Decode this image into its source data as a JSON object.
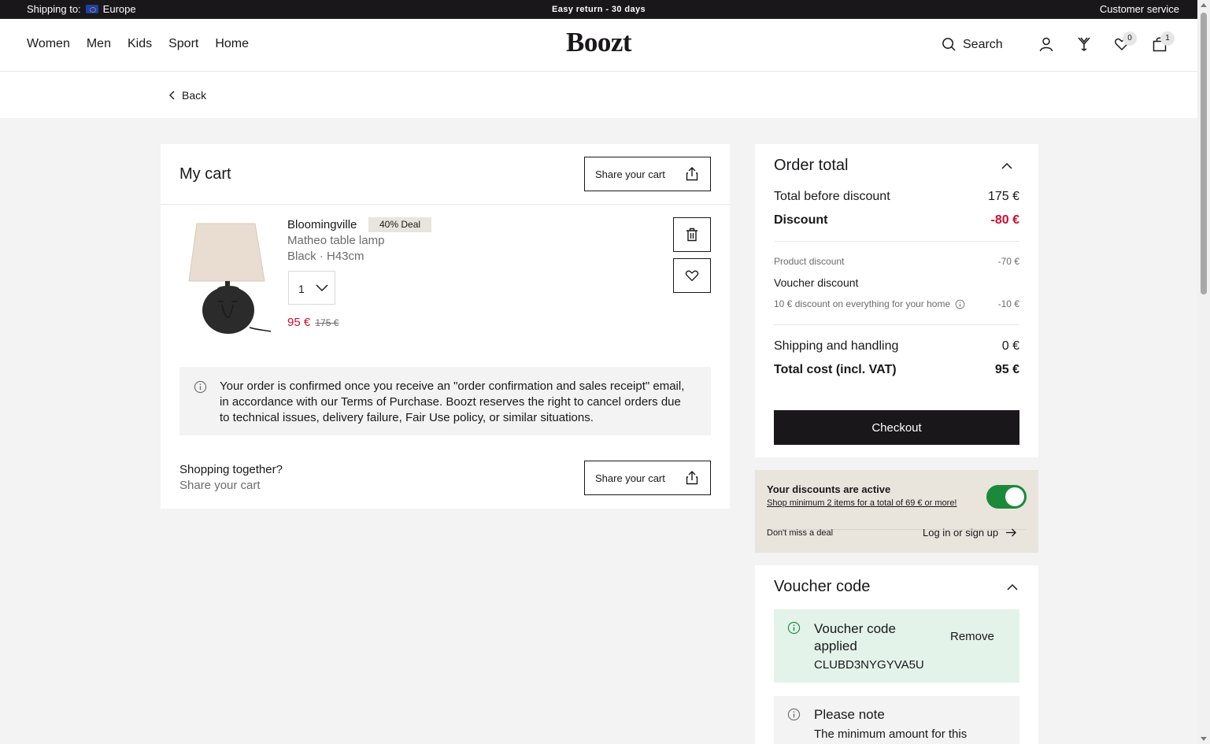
{
  "topbar": {
    "shipping_label": "Shipping to:",
    "shipping_region": "Europe",
    "promo": "Easy return - 30 days",
    "customer_service": "Customer service"
  },
  "header": {
    "nav": [
      "Women",
      "Men",
      "Kids",
      "Sport",
      "Home"
    ],
    "logo": "Boozt",
    "search_label": "Search",
    "wishlist_count": "0",
    "cart_count": "1"
  },
  "back_label": "Back",
  "cart": {
    "title": "My cart",
    "share_label": "Share your cart",
    "item": {
      "brand": "Bloomingville",
      "deal_badge": "40% Deal",
      "name": "Matheo table lamp",
      "variant": "Black · H43cm",
      "quantity": "1",
      "price": "95 €",
      "old_price": "175 €"
    },
    "notice": "Your order is confirmed once you receive an \"order confirmation and sales receipt\" email, in accordance with our Terms of Purchase. Boozt reserves the right to cancel orders due to technical issues, delivery failure, Fair Use policy, or similar situations.",
    "together_title": "Shopping together?",
    "together_sub": "Share your cart",
    "together_share_label": "Share your cart"
  },
  "order_total": {
    "title": "Order total",
    "before_discount_label": "Total before discount",
    "before_discount_value": "175 €",
    "discount_label": "Discount",
    "discount_value": "-80 €",
    "product_discount_label": "Product discount",
    "product_discount_value": "-70 €",
    "voucher_discount_label": "Voucher discount",
    "voucher_line_label": "10 € discount on everything for your home",
    "voucher_line_value": "-10 €",
    "shipping_label": "Shipping and handling",
    "shipping_value": "0 €",
    "total_label": "Total cost (incl. VAT)",
    "total_value": "95 €",
    "checkout_label": "Checkout"
  },
  "discounts": {
    "title": "Your discounts are active",
    "link": "Shop minimum 2 items for a total of 69 € or more!",
    "toggle_on": true,
    "dont_miss": "Don't miss a deal",
    "login_link": "Log in or sign up"
  },
  "voucher": {
    "title": "Voucher code",
    "applied_title": "Voucher code applied",
    "code": "CLUBD3NYGYVA5U",
    "remove_label": "Remove",
    "note_title": "Please note",
    "note_text": "The minimum amount for this"
  },
  "colors": {
    "dark": "#1a171b",
    "sale_red": "#c8102e",
    "toggle_green": "#1a8a3a",
    "deal_beige": "#e9e4dc",
    "applied_green": "#e3f3ea"
  }
}
